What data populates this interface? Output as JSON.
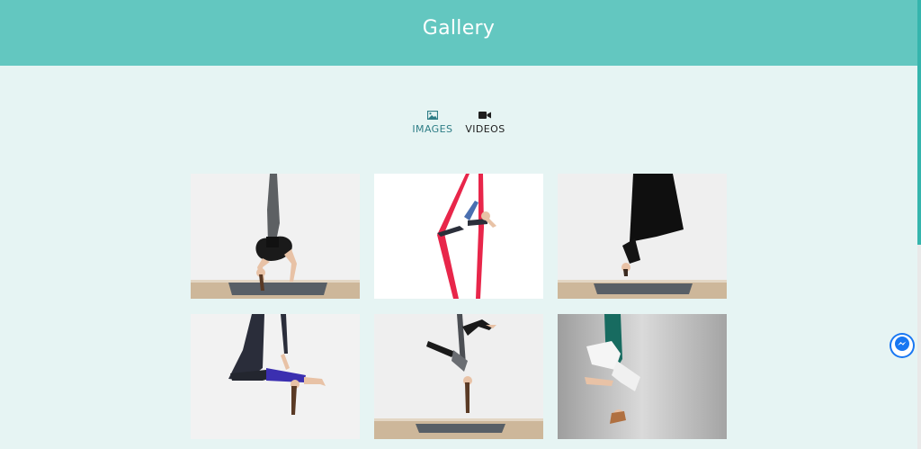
{
  "header": {
    "title": "Gallery"
  },
  "tabs": [
    {
      "label": "IMAGES",
      "icon": "image-icon",
      "active": true
    },
    {
      "label": "VIDEOS",
      "icon": "video-camera-icon",
      "active": false
    }
  ],
  "colors": {
    "header_bg": "#63c7c0",
    "page_bg": "#e6f4f3",
    "active_tab": "#2e7d86"
  },
  "gallery": {
    "items": [
      {
        "icon": "aerial-silk-backbend-photo"
      },
      {
        "icon": "aerial-silk-red-split-photo"
      },
      {
        "icon": "aerial-hammock-inversion-photo"
      },
      {
        "icon": "aerial-hammock-blue-outfit-photo"
      },
      {
        "icon": "aerial-hammock-split-photo"
      },
      {
        "icon": "aerial-hammock-green-photo"
      }
    ]
  },
  "chat": {
    "icon": "messenger-icon"
  }
}
